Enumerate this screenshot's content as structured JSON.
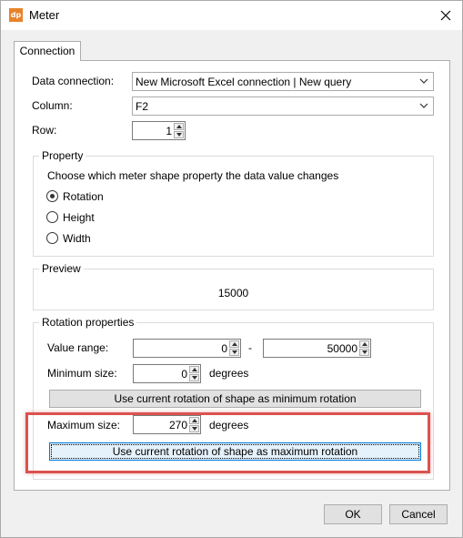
{
  "window": {
    "title": "Meter",
    "icon_text": "dp",
    "accent": "#e8832a"
  },
  "tabs": [
    {
      "label": "Connection"
    }
  ],
  "connection": {
    "data_connection_label": "Data connection:",
    "data_connection_value": "New Microsoft Excel connection | New query",
    "column_label": "Column:",
    "column_value": "F2",
    "row_label": "Row:",
    "row_value": "1"
  },
  "property": {
    "title": "Property",
    "description": "Choose which meter shape property the data value changes",
    "options": [
      {
        "label": "Rotation",
        "checked": true
      },
      {
        "label": "Height",
        "checked": false
      },
      {
        "label": "Width",
        "checked": false
      }
    ]
  },
  "preview": {
    "title": "Preview",
    "value": "15000"
  },
  "rotation": {
    "title": "Rotation properties",
    "value_range_label": "Value range:",
    "value_range_min": "0",
    "range_separator": "-",
    "value_range_max": "50000",
    "min_size_label": "Minimum size:",
    "min_size_value": "0",
    "min_unit": "degrees",
    "use_min_button": "Use current rotation of shape as minimum rotation",
    "max_size_label": "Maximum size:",
    "max_size_value": "270",
    "max_unit": "degrees",
    "use_max_button": "Use current rotation of shape as maximum rotation",
    "highlight_color": "#d9534f"
  },
  "footer": {
    "ok_label": "OK",
    "cancel_label": "Cancel"
  }
}
